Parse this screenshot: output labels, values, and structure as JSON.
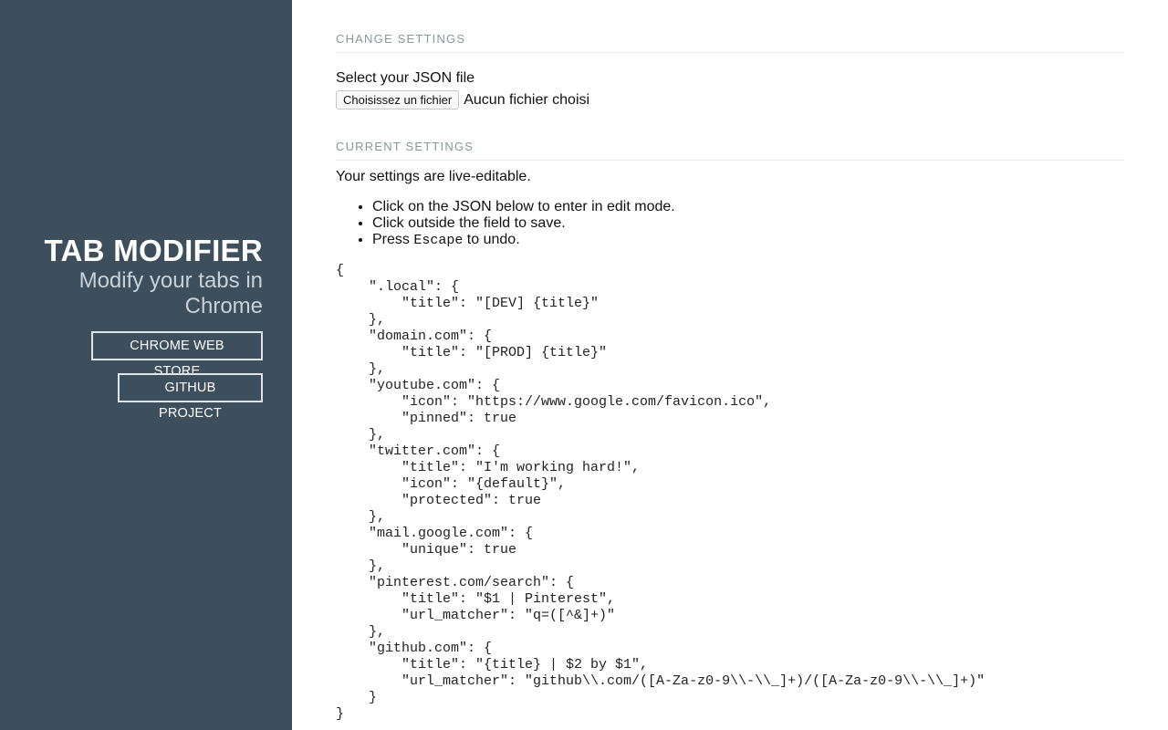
{
  "sidebar": {
    "title": "TAB MODIFIER",
    "subtitle": "Modify your tabs in Chrome",
    "buttons": {
      "store": "CHROME WEB STORE",
      "github": "GITHUB PROJECT"
    }
  },
  "change_settings": {
    "heading": "CHANGE SETTINGS",
    "file_label": "Select your JSON file",
    "file_button": "Choisissez un fichier",
    "file_status": "Aucun fichier choisi"
  },
  "current_settings": {
    "heading": "CURRENT SETTINGS",
    "intro": "Your settings are live-editable.",
    "instructions": {
      "item1": "Click on the JSON below to enter in edit mode.",
      "item2": "Click outside the field to save.",
      "item3_before": "Press ",
      "item3_code": "Escape",
      "item3_after": " to undo."
    },
    "json_text": "{\n    \".local\": {\n        \"title\": \"[DEV] {title}\"\n    },\n    \"domain.com\": {\n        \"title\": \"[PROD] {title}\"\n    },\n    \"youtube.com\": {\n        \"icon\": \"https://www.google.com/favicon.ico\",\n        \"pinned\": true\n    },\n    \"twitter.com\": {\n        \"title\": \"I'm working hard!\",\n        \"icon\": \"{default}\",\n        \"protected\": true\n    },\n    \"mail.google.com\": {\n        \"unique\": true\n    },\n    \"pinterest.com/search\": {\n        \"title\": \"$1 | Pinterest\",\n        \"url_matcher\": \"q=([^&]+)\"\n    },\n    \"github.com\": {\n        \"title\": \"{title} | $2 by $1\",\n        \"url_matcher\": \"github\\\\.com/([A-Za-z0-9\\\\-\\\\_]+)/([A-Za-z0-9\\\\-\\\\_]+)\"\n    }\n}"
  }
}
